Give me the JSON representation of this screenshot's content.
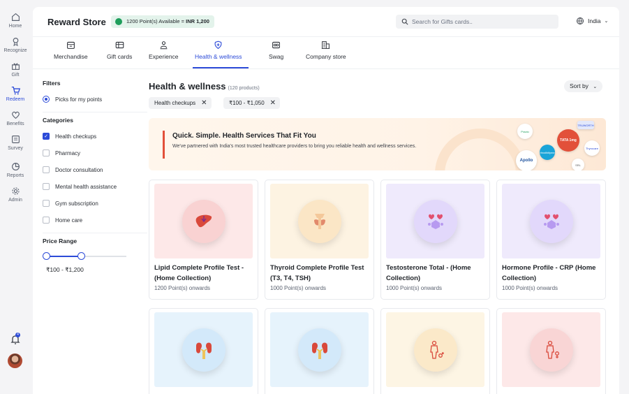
{
  "rail": {
    "items": [
      {
        "label": "Home",
        "icon": "home-icon"
      },
      {
        "label": "Recognize",
        "icon": "award-icon"
      },
      {
        "label": "Gift",
        "icon": "gift-icon"
      },
      {
        "label": "Redeem",
        "icon": "cart-icon"
      },
      {
        "label": "Benefits",
        "icon": "heart-icon"
      },
      {
        "label": "Survey",
        "icon": "survey-icon"
      },
      {
        "label": "Reports",
        "icon": "pie-icon"
      },
      {
        "label": "Admin",
        "icon": "gear-icon"
      }
    ],
    "notification_count": "4"
  },
  "header": {
    "title": "Reward Store",
    "points_text": "1200 Point(s) Available = ",
    "points_value": "INR 1,200",
    "search_placeholder": "Search for Gifts cards..",
    "region": "India"
  },
  "tabs": [
    {
      "label": "Merchandise"
    },
    {
      "label": "Gift cards"
    },
    {
      "label": "Experience"
    },
    {
      "label": "Health & wellness"
    },
    {
      "label": "Swag"
    },
    {
      "label": "Company store"
    }
  ],
  "filters": {
    "title": "Filters",
    "picks": "Picks for my points",
    "categories_title": "Categories",
    "categories": [
      {
        "label": "Health checkups",
        "checked": true
      },
      {
        "label": "Pharmacy",
        "checked": false
      },
      {
        "label": "Doctor consultation",
        "checked": false
      },
      {
        "label": "Mental health assistance",
        "checked": false
      },
      {
        "label": "Gym subscription",
        "checked": false
      },
      {
        "label": "Home care",
        "checked": false
      }
    ],
    "price_title": "Price Range",
    "price_text": "₹100 - ₹1,200"
  },
  "content": {
    "title": "Health & wellness",
    "count": "(120 products)",
    "sort": "Sort by",
    "chips": [
      "Health checkups",
      "₹100 - ₹1,050"
    ]
  },
  "banner": {
    "title": "Quick. Simple. Health Services That Fit You",
    "subtitle": "We've partnered with India's most trusted healthcare providers to bring you reliable health and wellness services.",
    "logos": [
      "Apollo",
      "TATA 1mg",
      "SRL",
      "Healthifyme",
      "Thyrocare",
      "Practo",
      "TRUWORTH"
    ]
  },
  "products": [
    {
      "name": "Lipid Complete Profile Test - (Home Collection)",
      "points": "1200 Point(s) onwards",
      "bg": "#fde8e8",
      "circle": "#f9d2d2",
      "icon": "liver-icon"
    },
    {
      "name": "Thyroid Complete Profile Test (T3, T4, TSH)",
      "points": "1000 Point(s) onwards",
      "bg": "#fdf3e2",
      "circle": "#fbe6c6",
      "icon": "thyroid-icon"
    },
    {
      "name": "Testosterone Total - (Home Collection)",
      "points": "1000 Point(s) onwards",
      "bg": "#efeafc",
      "circle": "#e2d8fb",
      "icon": "hormone-icon"
    },
    {
      "name": "Hormone Profile - CRP (Home Collection)",
      "points": "1000 Point(s) onwards",
      "bg": "#efeafc",
      "circle": "#e2d8fb",
      "icon": "hormone-icon"
    },
    {
      "name": "",
      "points": "",
      "bg": "#e6f3fc",
      "circle": "#d3e9fa",
      "icon": "kidney-icon"
    },
    {
      "name": "",
      "points": "",
      "bg": "#e6f3fc",
      "circle": "#d3e9fa",
      "icon": "kidney-icon"
    },
    {
      "name": "",
      "points": "",
      "bg": "#fdf5e4",
      "circle": "#fbe9c9",
      "icon": "male-body-icon"
    },
    {
      "name": "",
      "points": "",
      "bg": "#fde8e8",
      "circle": "#f9d5d5",
      "icon": "female-body-icon"
    }
  ],
  "colors": {
    "accent": "#2c4bd8",
    "points_green": "#1e9e5b",
    "banner_red": "#e2503a"
  }
}
